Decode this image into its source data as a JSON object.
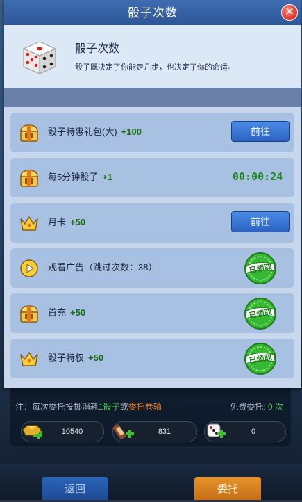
{
  "modal": {
    "title": "骰子次数",
    "info": {
      "title": "骰子次数",
      "description": "骰子既决定了你能走几步，也决定了你的命运。"
    },
    "rows": [
      {
        "icon": "gift-chest-icon",
        "label": "骰子特惠礼包(大)",
        "bonus": "+100",
        "action": "button",
        "button_label": "前往"
      },
      {
        "icon": "gift-chest-icon",
        "label": "每5分钟骰子",
        "bonus": "+1",
        "action": "timer",
        "timer": "00:00:24"
      },
      {
        "icon": "crown-icon",
        "label": "月卡",
        "bonus": "+50",
        "action": "button",
        "button_label": "前往"
      },
      {
        "icon": "play-circle-icon",
        "label": "观看广告（跳过次数：38）",
        "bonus": "",
        "action": "claimed",
        "badge_label": "已领取"
      },
      {
        "icon": "gift-chest-icon",
        "label": "首充",
        "bonus": "+50",
        "action": "claimed",
        "badge_label": "已领取"
      },
      {
        "icon": "crown-icon",
        "label": "骰子特权",
        "bonus": "+50",
        "action": "claimed",
        "badge_label": "已领取"
      }
    ]
  },
  "background": {
    "note_prefix": "注：每次委托投掷消耗",
    "note_green": "1骰子",
    "note_or": "或",
    "note_orange": "委托卷轴",
    "free_label": "免费委托:",
    "free_value": "0 次",
    "resources": [
      {
        "icon": "gold-ingot-icon",
        "value": "10540"
      },
      {
        "icon": "scroll-icon",
        "value": "831"
      },
      {
        "icon": "dice-icon",
        "value": "0"
      }
    ],
    "back_label": "返回",
    "entrust_label": "委托"
  },
  "colors": {
    "header_blue": "#2d5699",
    "row_blue": "#a8c0e2",
    "bonus_green": "#1b6e10",
    "timer_green": "#1c8a1c",
    "claimed_green": "#2fae2f"
  }
}
